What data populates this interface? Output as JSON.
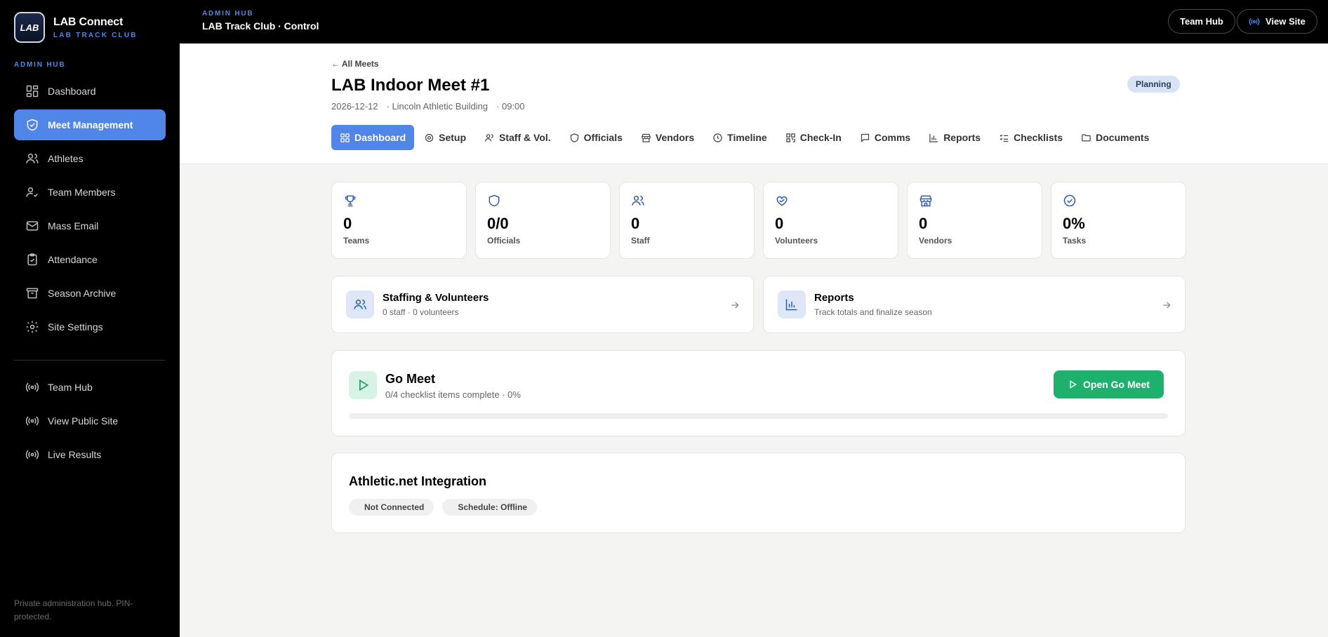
{
  "brand": {
    "logo_text": "LAB",
    "title": "LAB Connect",
    "subtitle": "LAB TRACK CLUB"
  },
  "sidebar": {
    "section_label": "ADMIN HUB",
    "items": [
      {
        "label": "Dashboard",
        "icon": "dashboard-icon"
      },
      {
        "label": "Meet Management",
        "icon": "shield-check-icon",
        "active": true
      },
      {
        "label": "Athletes",
        "icon": "users-icon"
      },
      {
        "label": "Team Members",
        "icon": "user-check-icon"
      },
      {
        "label": "Mass Email",
        "icon": "mail-icon"
      },
      {
        "label": "Attendance",
        "icon": "clipboard-check-icon"
      },
      {
        "label": "Season Archive",
        "icon": "archive-icon"
      },
      {
        "label": "Site Settings",
        "icon": "gear-icon"
      }
    ],
    "bottom_items": [
      {
        "label": "Team Hub",
        "icon": "broadcast-icon"
      },
      {
        "label": "View Public Site",
        "icon": "broadcast-icon"
      },
      {
        "label": "Live Results",
        "icon": "broadcast-icon"
      }
    ],
    "footer": "Private administration hub. PIN-protected."
  },
  "topbar": {
    "eyebrow": "ADMIN HUB",
    "title": "LAB Track Club · Control",
    "team_hub_label": "Team Hub",
    "view_site_label": "View Site"
  },
  "meet": {
    "back_label": "← All Meets",
    "title": "LAB Indoor Meet #1",
    "date": "2026-12-12",
    "location": "· Lincoln Athletic Building",
    "time": "· 09:00",
    "status": "Planning"
  },
  "tabs": [
    {
      "label": "Dashboard",
      "icon": "dashboard-icon",
      "active": true
    },
    {
      "label": "Setup",
      "icon": "gear-icon"
    },
    {
      "label": "Staff & Vol.",
      "icon": "users-icon"
    },
    {
      "label": "Officials",
      "icon": "shield-icon"
    },
    {
      "label": "Vendors",
      "icon": "store-icon"
    },
    {
      "label": "Timeline",
      "icon": "clock-icon"
    },
    {
      "label": "Check-In",
      "icon": "qr-icon"
    },
    {
      "label": "Comms",
      "icon": "message-icon"
    },
    {
      "label": "Reports",
      "icon": "bar-chart-icon"
    },
    {
      "label": "Checklists",
      "icon": "list-check-icon"
    },
    {
      "label": "Documents",
      "icon": "folder-icon"
    }
  ],
  "stats": [
    {
      "value": "0",
      "label": "Teams",
      "icon": "trophy-icon"
    },
    {
      "value": "0/0",
      "label": "Officials",
      "icon": "shield-icon"
    },
    {
      "value": "0",
      "label": "Staff",
      "icon": "users-icon"
    },
    {
      "value": "0",
      "label": "Volunteers",
      "icon": "heart-hand-icon"
    },
    {
      "value": "0",
      "label": "Vendors",
      "icon": "store-icon"
    },
    {
      "value": "0%",
      "label": "Tasks",
      "icon": "check-circle-icon"
    }
  ],
  "cards": {
    "staffing": {
      "title": "Staffing & Volunteers",
      "subtitle": "0 staff · 0 volunteers"
    },
    "reports": {
      "title": "Reports",
      "subtitle": "Track totals and finalize season"
    }
  },
  "gomeet": {
    "title": "Go Meet",
    "subtitle": "0/4 checklist items complete · 0%",
    "button_label": "Open Go Meet",
    "progress": 0
  },
  "integration": {
    "title": "Athletic.net Integration",
    "status": "Not Connected",
    "schedule": "Schedule: Offline"
  },
  "colors": {
    "accent": "#4f86e8",
    "success": "#1db16d",
    "sidebar_bg": "#000000"
  }
}
